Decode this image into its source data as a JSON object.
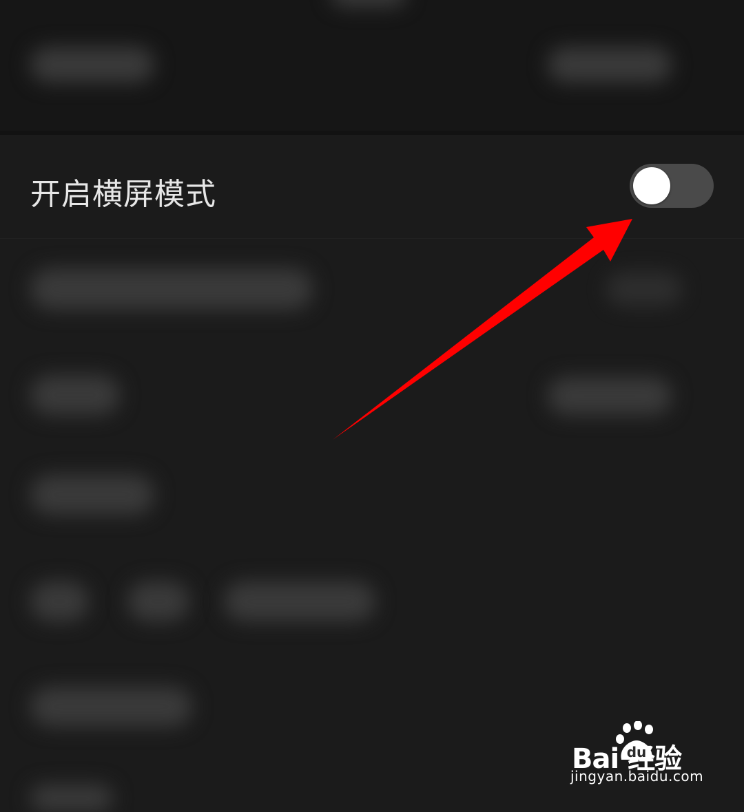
{
  "setting": {
    "label": "开启横屏模式",
    "toggle_on": false
  },
  "annotation": {
    "arrow_color": "#ff0000"
  },
  "watermark": {
    "brand": "Bai  经验",
    "paw_text": "du",
    "url": "jingyan.baidu.com"
  }
}
